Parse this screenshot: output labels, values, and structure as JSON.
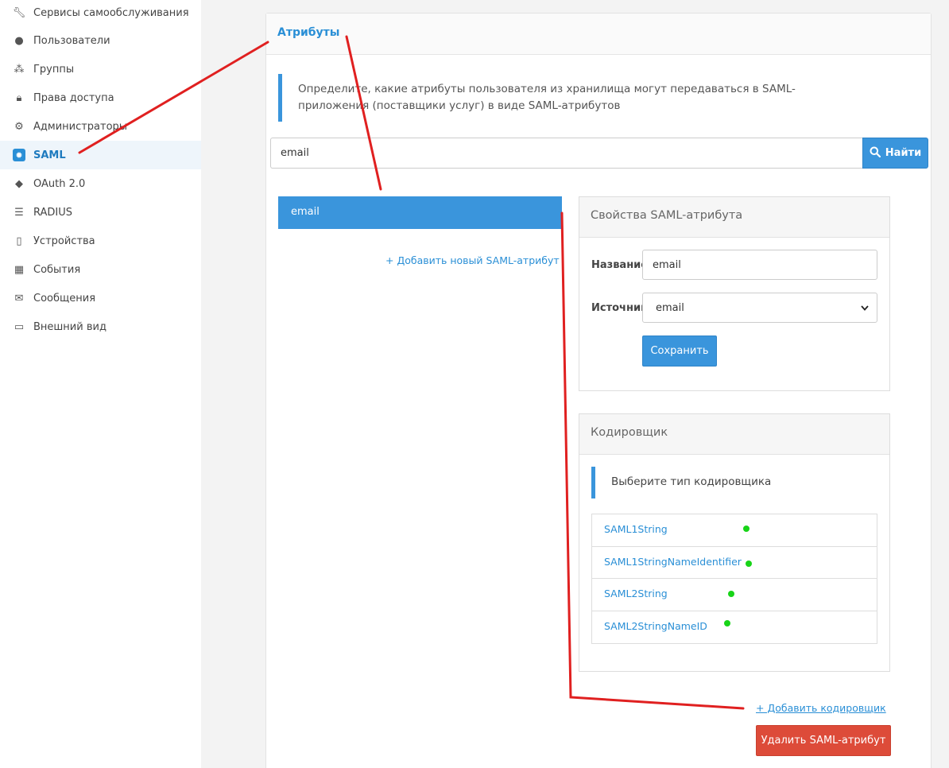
{
  "sidebar": {
    "items": [
      {
        "label": "Сервисы самообслуживания",
        "icon": "wrench-icon",
        "active": false
      },
      {
        "label": "Пользователи",
        "icon": "user-icon",
        "active": false
      },
      {
        "label": "Группы",
        "icon": "users-icon",
        "active": false
      },
      {
        "label": "Права доступа",
        "icon": "lock-icon",
        "active": false
      },
      {
        "label": "Администраторы",
        "icon": "gear-icon",
        "active": false
      },
      {
        "label": "SAML",
        "icon": "badge-icon",
        "active": true
      },
      {
        "label": "OAuth 2.0",
        "icon": "tag-icon",
        "active": false
      },
      {
        "label": "RADIUS",
        "icon": "server-icon",
        "active": false
      },
      {
        "label": "Устройства",
        "icon": "mobile-icon",
        "active": false
      },
      {
        "label": "События",
        "icon": "calendar-icon",
        "active": false
      },
      {
        "label": "Сообщения",
        "icon": "envelope-icon",
        "active": false
      },
      {
        "label": "Внешний вид",
        "icon": "monitor-icon",
        "active": false
      }
    ]
  },
  "main": {
    "title": "Атрибуты",
    "description": "Определите, какие атрибуты пользователя из хранилища могут передаваться в SAML-приложения (поставщики услуг) в виде SAML-атрибутов",
    "search": {
      "value": "email",
      "button_label": "Найти"
    },
    "attributes": [
      {
        "label": "email",
        "selected": true
      }
    ],
    "add_attribute_label": "+ Добавить новый SAML-атрибут",
    "properties": {
      "title": "Свойства SAML-атрибута",
      "name_label": "Название",
      "name_value": "email",
      "source_label": "Источник",
      "source_value": "email",
      "save_label": "Сохранить"
    },
    "encoder": {
      "title": "Кодировщик",
      "hint": "Выберите тип кодировщика",
      "items": [
        "SAML1String",
        "SAML1StringNameIdentifier",
        "SAML2String",
        "SAML2StringNameID"
      ]
    },
    "add_encoder_label": "+ Добавить кодировщик",
    "delete_label": "Удалить SAML-атрибут"
  },
  "colors": {
    "accent": "#3a95dc",
    "danger": "#dd4b39",
    "annotation_line": "#e02020",
    "annotation_dot": "#18d418"
  }
}
